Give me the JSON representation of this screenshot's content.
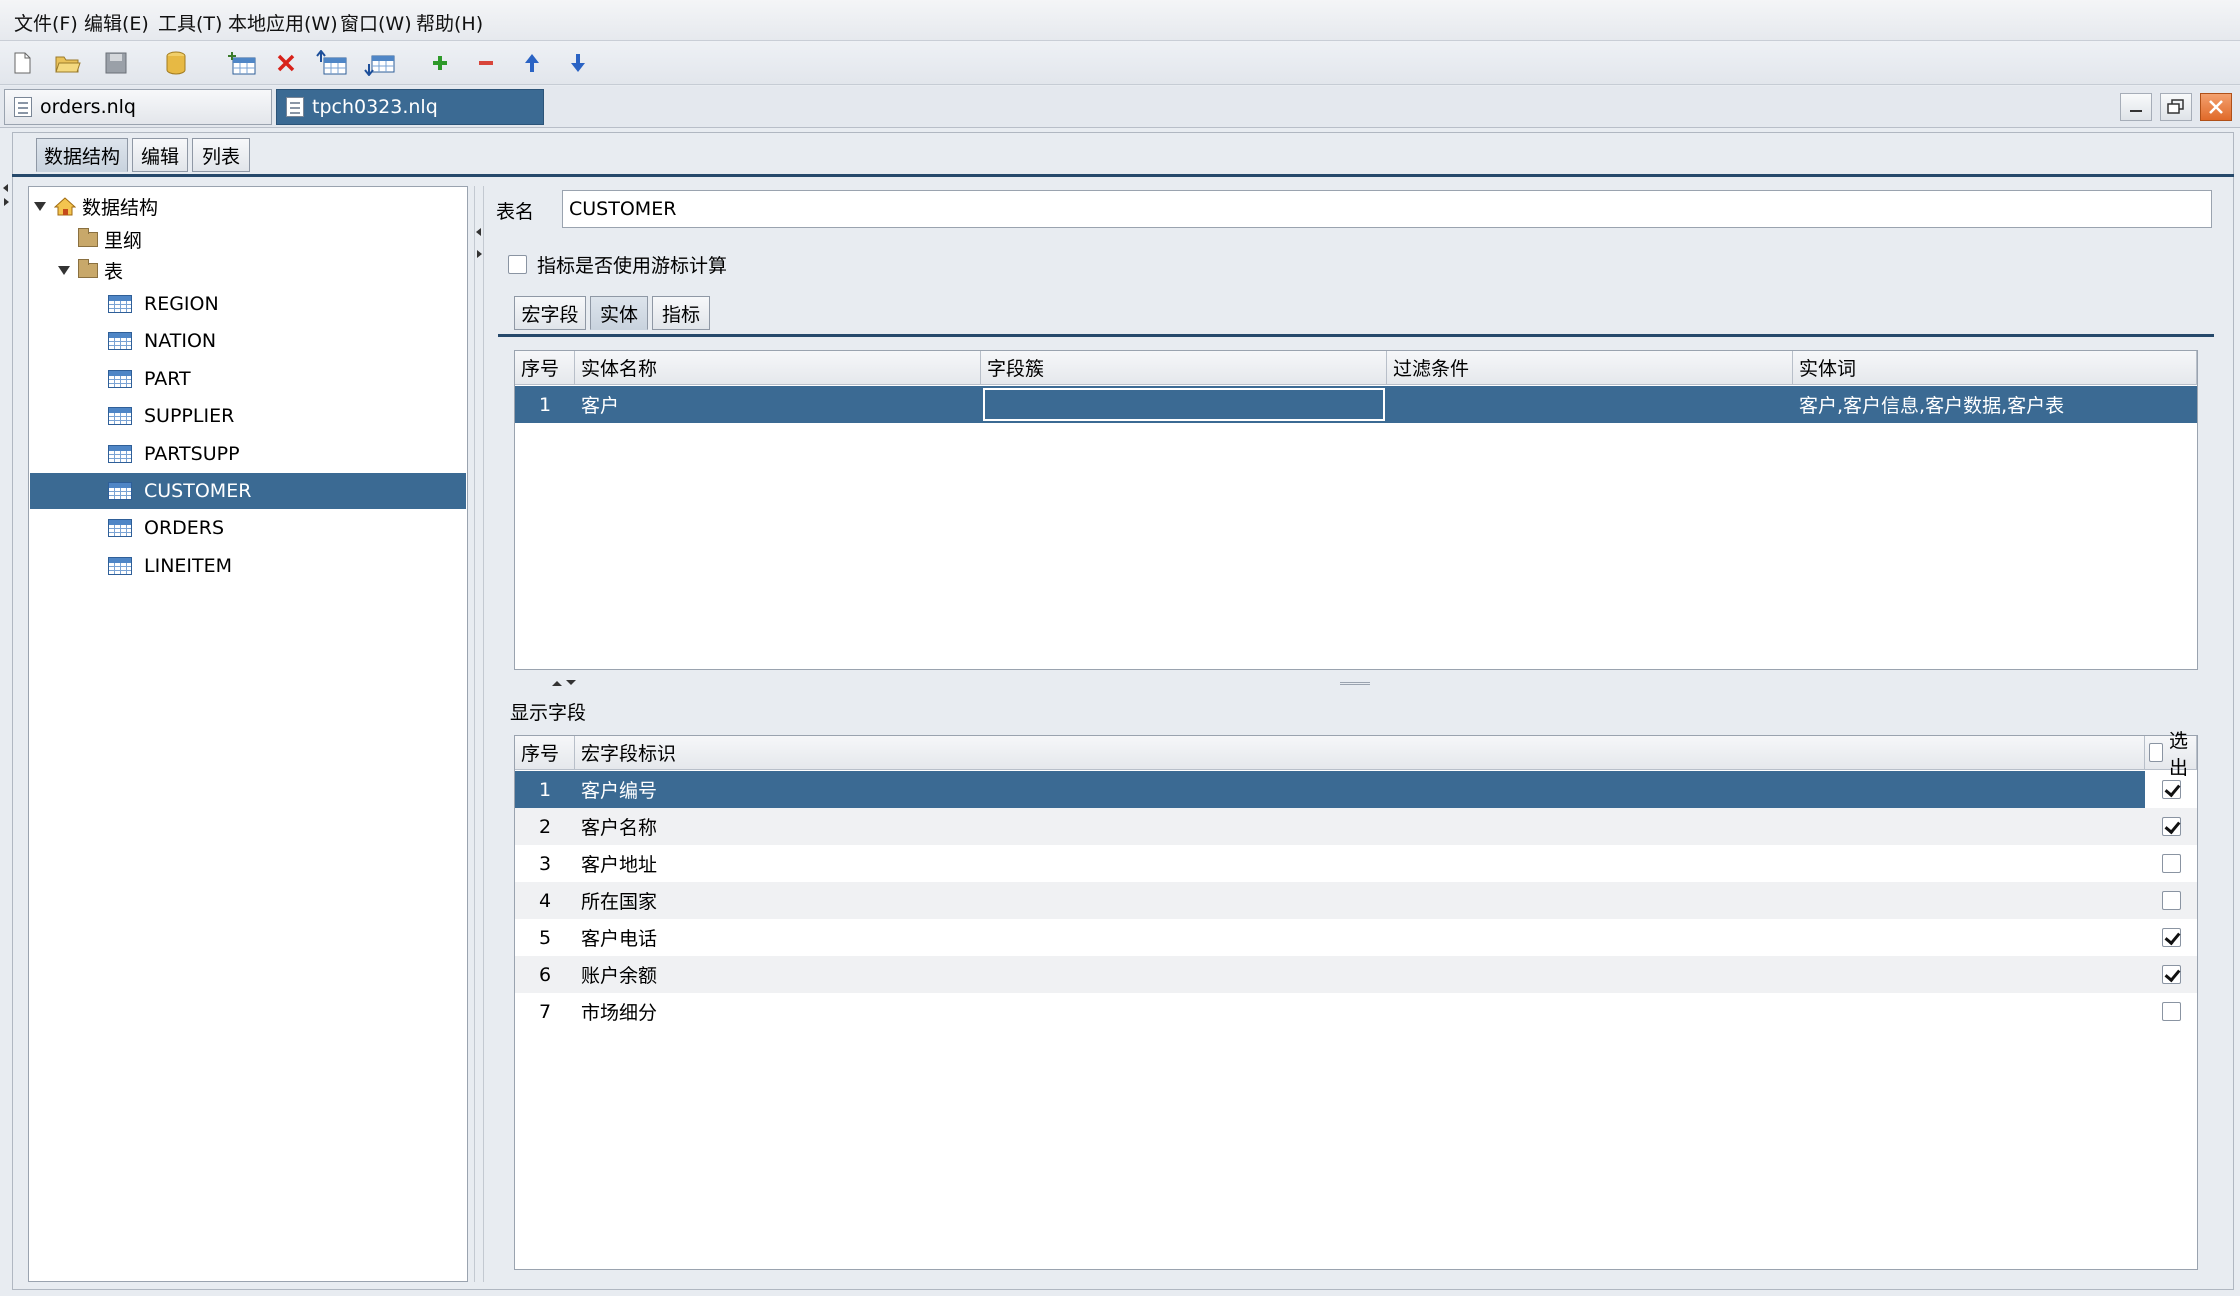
{
  "menu": [
    "文件(F)",
    "编辑(E)",
    "工具(T)",
    "本地应用(W)",
    "窗口(W)",
    "帮助(H)"
  ],
  "file_tabs": [
    {
      "label": "orders.nlq",
      "active": false
    },
    {
      "label": "tpch0323.nlq",
      "active": true
    }
  ],
  "view_tabs": [
    "数据结构",
    "编辑",
    "列表"
  ],
  "tree": {
    "root": "数据结构",
    "outline": "里纲",
    "tables_folder": "表",
    "tables": [
      "REGION",
      "NATION",
      "PART",
      "SUPPLIER",
      "PARTSUPP",
      "CUSTOMER",
      "ORDERS",
      "LINEITEM"
    ],
    "selected": "CUSTOMER"
  },
  "detail": {
    "table_name_label": "表名",
    "table_name_value": "CUSTOMER",
    "cursor_checkbox_label": "指标是否使用游标计算",
    "cursor_checked": false,
    "sub_tabs": [
      "宏字段",
      "实体",
      "指标"
    ],
    "selected_sub_tab": "实体"
  },
  "entity_table": {
    "columns": [
      "序号",
      "实体名称",
      "字段簇",
      "过滤条件",
      "实体词"
    ],
    "rows": [
      {
        "no": "1",
        "name": "客户",
        "cluster": "",
        "filter": "",
        "words": "客户,客户信息,客户数据,客户表"
      }
    ]
  },
  "display_fields": {
    "title": "显示字段",
    "columns": [
      "序号",
      "宏字段标识",
      "选出"
    ],
    "header_checked": false,
    "rows": [
      {
        "no": "1",
        "name": "客户编号",
        "checked": true
      },
      {
        "no": "2",
        "name": "客户名称",
        "checked": true
      },
      {
        "no": "3",
        "name": "客户地址",
        "checked": false
      },
      {
        "no": "4",
        "name": "所在国家",
        "checked": false
      },
      {
        "no": "5",
        "name": "客户电话",
        "checked": true
      },
      {
        "no": "6",
        "name": "账户余额",
        "checked": true
      },
      {
        "no": "7",
        "name": "市场细分",
        "checked": false
      }
    ]
  },
  "colors": {
    "selection": "#3b6a93",
    "background": "#e8ecf1"
  }
}
